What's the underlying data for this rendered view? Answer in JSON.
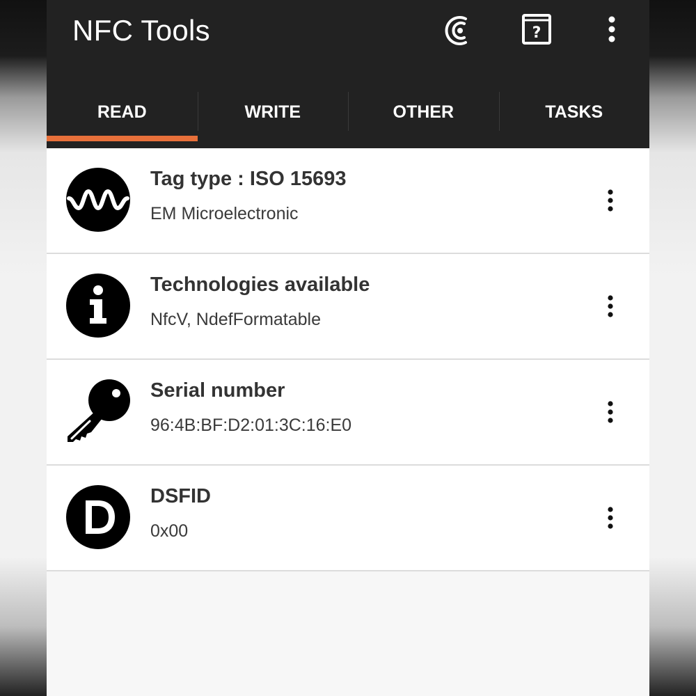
{
  "appbar": {
    "title": "NFC Tools",
    "background": "#222222",
    "actions": [
      {
        "icon": "nfc-c-icon"
      },
      {
        "icon": "help-book-icon"
      },
      {
        "icon": "more-vert-icon"
      }
    ]
  },
  "tabs": {
    "items": [
      {
        "label": "READ",
        "selected": true
      },
      {
        "label": "WRITE",
        "selected": false
      },
      {
        "label": "OTHER",
        "selected": false
      },
      {
        "label": "TASKS",
        "selected": false
      }
    ],
    "indicator_color": "#e8703a"
  },
  "rows": [
    {
      "icon": "wave-icon",
      "title": "Tag type : ISO 15693",
      "subtitle": "EM Microelectronic"
    },
    {
      "icon": "info-icon",
      "title": "Technologies available",
      "subtitle": "NfcV, NdefFormatable"
    },
    {
      "icon": "key-icon",
      "title": "Serial number",
      "subtitle": "96:4B:BF:D2:01:3C:16:E0"
    },
    {
      "icon": "d-letter-icon",
      "title": "DSFID",
      "subtitle": "0x00"
    }
  ]
}
